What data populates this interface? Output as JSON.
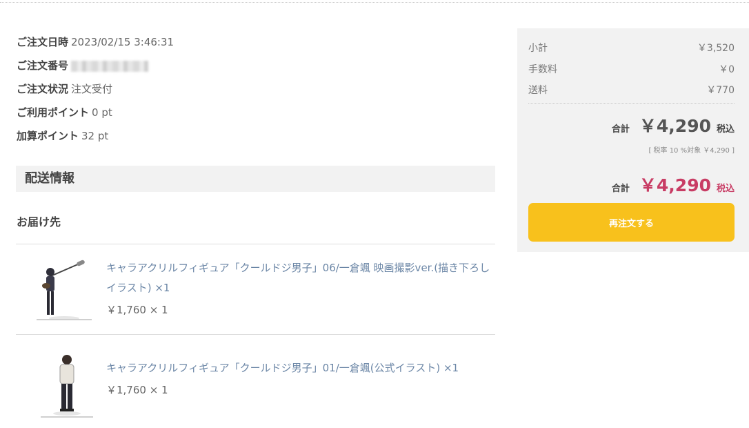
{
  "order": {
    "date_label": "ご注文日時",
    "date_value": "2023/02/15 3:46:31",
    "number_label": "ご注文番号",
    "status_label": "ご注文状況",
    "status_value": "注文受付",
    "points_used_label": "ご利用ポイント",
    "points_used_value": "0 pt",
    "points_added_label": "加算ポイント",
    "points_added_value": "32 pt"
  },
  "delivery": {
    "section_title": "配送情報",
    "destination_label": "お届け先"
  },
  "items": [
    {
      "name": "キャラアクリルフィギュア「クールドジ男子」06/一倉颯 映画撮影ver.(描き下ろしイラスト) ×1",
      "price": "￥1,760 × 1"
    },
    {
      "name": "キャラアクリルフィギュア「クールドジ男子」01/一倉颯(公式イラスト) ×1",
      "price": "￥1,760 × 1"
    }
  ],
  "summary": {
    "subtotal_label": "小計",
    "subtotal_value": "￥3,520",
    "fee_label": "手数料",
    "fee_value": "￥0",
    "shipping_label": "送料",
    "shipping_value": "￥770",
    "total_label": "合計",
    "total_value": "￥4,290",
    "tax_included": "税込",
    "tax_note": "[ 税率 10 %対象 ￥4,290 ]",
    "grand_total_label": "合計",
    "grand_total_value": "￥4,290",
    "grand_tax_included": "税込",
    "reorder_label": "再注文する"
  },
  "colors": {
    "link": "#6b86a6",
    "accent_total": "#c83c64",
    "button": "#f8c11c",
    "panel_bg": "#f2f2f2"
  }
}
